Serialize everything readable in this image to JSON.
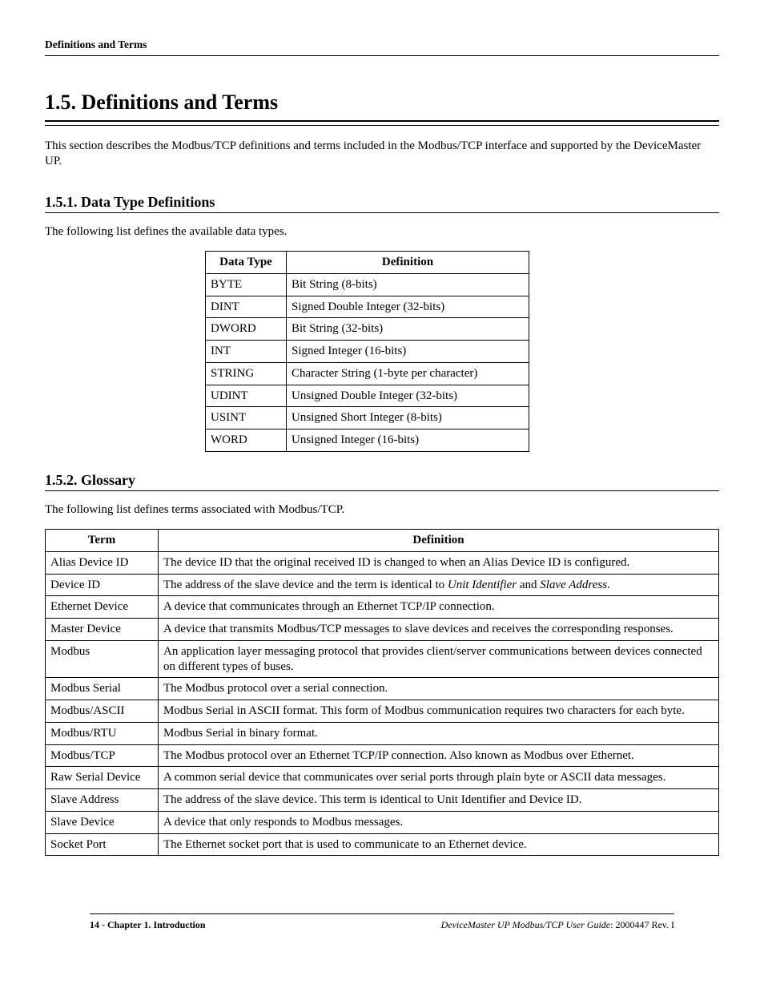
{
  "running_head": "Definitions and Terms",
  "section": {
    "number": "1.5.",
    "title": "Definitions and Terms",
    "intro": "This section describes the Modbus/TCP definitions and terms included in the Modbus/TCP interface and supported by the DeviceMaster UP."
  },
  "dtypes": {
    "number": "1.5.1.",
    "title": "Data Type Definitions",
    "intro": "The following list defines the available data types.",
    "col1": "Data Type",
    "col2": "Definition",
    "rows": [
      {
        "t": "BYTE",
        "d": "Bit String (8-bits)"
      },
      {
        "t": "DINT",
        "d": "Signed Double Integer (32-bits)"
      },
      {
        "t": "DWORD",
        "d": "Bit String (32-bits)"
      },
      {
        "t": "INT",
        "d": "Signed Integer (16-bits)"
      },
      {
        "t": "STRING",
        "d": "Character String (1-byte per character)"
      },
      {
        "t": "UDINT",
        "d": "Unsigned Double Integer (32-bits)"
      },
      {
        "t": "USINT",
        "d": "Unsigned Short Integer (8-bits)"
      },
      {
        "t": "WORD",
        "d": "Unsigned Integer (16-bits)"
      }
    ]
  },
  "glossary": {
    "number": "1.5.2.",
    "title": "Glossary",
    "intro": "The following list defines terms associated with Modbus/TCP.",
    "col1": "Term",
    "col2": "Definition",
    "rows": [
      {
        "t": "Alias Device ID",
        "d": "The device ID that the original received ID is changed to when an Alias Device ID is configured."
      },
      {
        "t": "Device ID",
        "d_pre": "The address of the slave device and the term is identical to ",
        "d_i1": "Unit Identifier",
        "d_mid": " and ",
        "d_i2": "Slave Address",
        "d_post": "."
      },
      {
        "t": "Ethernet Device",
        "d": "A device that communicates through an Ethernet TCP/IP connection."
      },
      {
        "t": "Master Device",
        "d": "A device that transmits Modbus/TCP messages to slave devices and receives the corresponding responses."
      },
      {
        "t": "Modbus",
        "d": "An application layer messaging protocol that provides client/server communications between devices connected on different types of buses."
      },
      {
        "t": "Modbus Serial",
        "d": "The Modbus protocol over a serial connection."
      },
      {
        "t": "Modbus/ASCII",
        "d": "Modbus Serial in ASCII format. This form of Modbus communication requires two characters for each byte."
      },
      {
        "t": "Modbus/RTU",
        "d": "Modbus Serial in binary format."
      },
      {
        "t": "Modbus/TCP",
        "d": "The Modbus protocol over an Ethernet TCP/IP connection. Also known as Modbus over Ethernet."
      },
      {
        "t": "Raw Serial Device",
        "d": "A common serial device that communicates over serial ports through plain byte or ASCII data messages."
      },
      {
        "t": "Slave Address",
        "d": "The address of the slave device. This term is identical to Unit Identifier and Device ID."
      },
      {
        "t": "Slave Device",
        "d": "A device that only responds to Modbus messages."
      },
      {
        "t": "Socket Port",
        "d": "The Ethernet socket port that is used to communicate to an Ethernet device."
      }
    ]
  },
  "footer": {
    "page_label": "14 - Chapter 1. Introduction",
    "doc_title": "DeviceMaster UP Modbus/TCP User Guide",
    "doc_rev": ": 2000447 Rev. I"
  }
}
